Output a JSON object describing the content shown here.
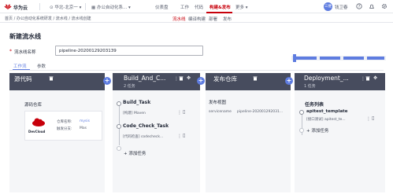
{
  "header": {
    "brand": "华为云",
    "region": "华北-北京一",
    "project": "办公自动化系...",
    "nav": [
      {
        "label": "仪表盘",
        "active": false
      },
      {
        "label": "工作",
        "active": false
      },
      {
        "label": "代码",
        "active": false
      },
      {
        "label": "构建&发布",
        "active": true
      },
      {
        "label": "更多",
        "active": false
      }
    ],
    "avatar_text": "三维",
    "username": "钱卫春"
  },
  "subnav": {
    "breadcrumb": "首页 / 办公自动化系统研发 / 流水线 / 流水线创建",
    "tabs": [
      {
        "label": "流水线",
        "active": true
      },
      {
        "label": "编译构建",
        "active": false
      },
      {
        "label": "部署",
        "active": false
      },
      {
        "label": "发布",
        "active": false
      }
    ]
  },
  "page": {
    "title": "新建流水线",
    "name_label": "流水线名称",
    "name_value": "pipeline-20200129203139",
    "tabs": [
      {
        "label": "工作流",
        "active": true
      },
      {
        "label": "参数",
        "active": false
      }
    ]
  },
  "stages": [
    {
      "title": "源代码",
      "sub": ""
    },
    {
      "title": "Build_And_C...",
      "sub": "2 任务"
    },
    {
      "title": "发布仓库",
      "sub": ""
    },
    {
      "title": "Deployment_...",
      "sub": "1 任务"
    }
  ],
  "source": {
    "header": "源码仓库",
    "repo_label": "仓库名称:",
    "repo_value": "mysis",
    "branch_label": "触发分支:",
    "branch_value": "Mas",
    "logo_text": "DevCloud"
  },
  "build": {
    "tasks": [
      {
        "name": "Build_Task",
        "desc": "[构建] Maven"
      },
      {
        "name": "Code_Check_Task",
        "desc": "[代码检查] codecheck..."
      }
    ],
    "add_label": "+ 添加任务"
  },
  "release": {
    "header": "发布视图",
    "row_label": "servicename",
    "row_value": "pipeline-202001292031..."
  },
  "deploy": {
    "header": "任务列表",
    "task_name": "apitest_template",
    "task_desc": "[接口测试] apitest_te...",
    "add_label": "+ 添加任务"
  },
  "colors": {
    "brand_red": "#c7000b",
    "accent": "#5e7ce0",
    "stage_bg": "#474c5e",
    "col_bg": "#f5f6f8"
  }
}
